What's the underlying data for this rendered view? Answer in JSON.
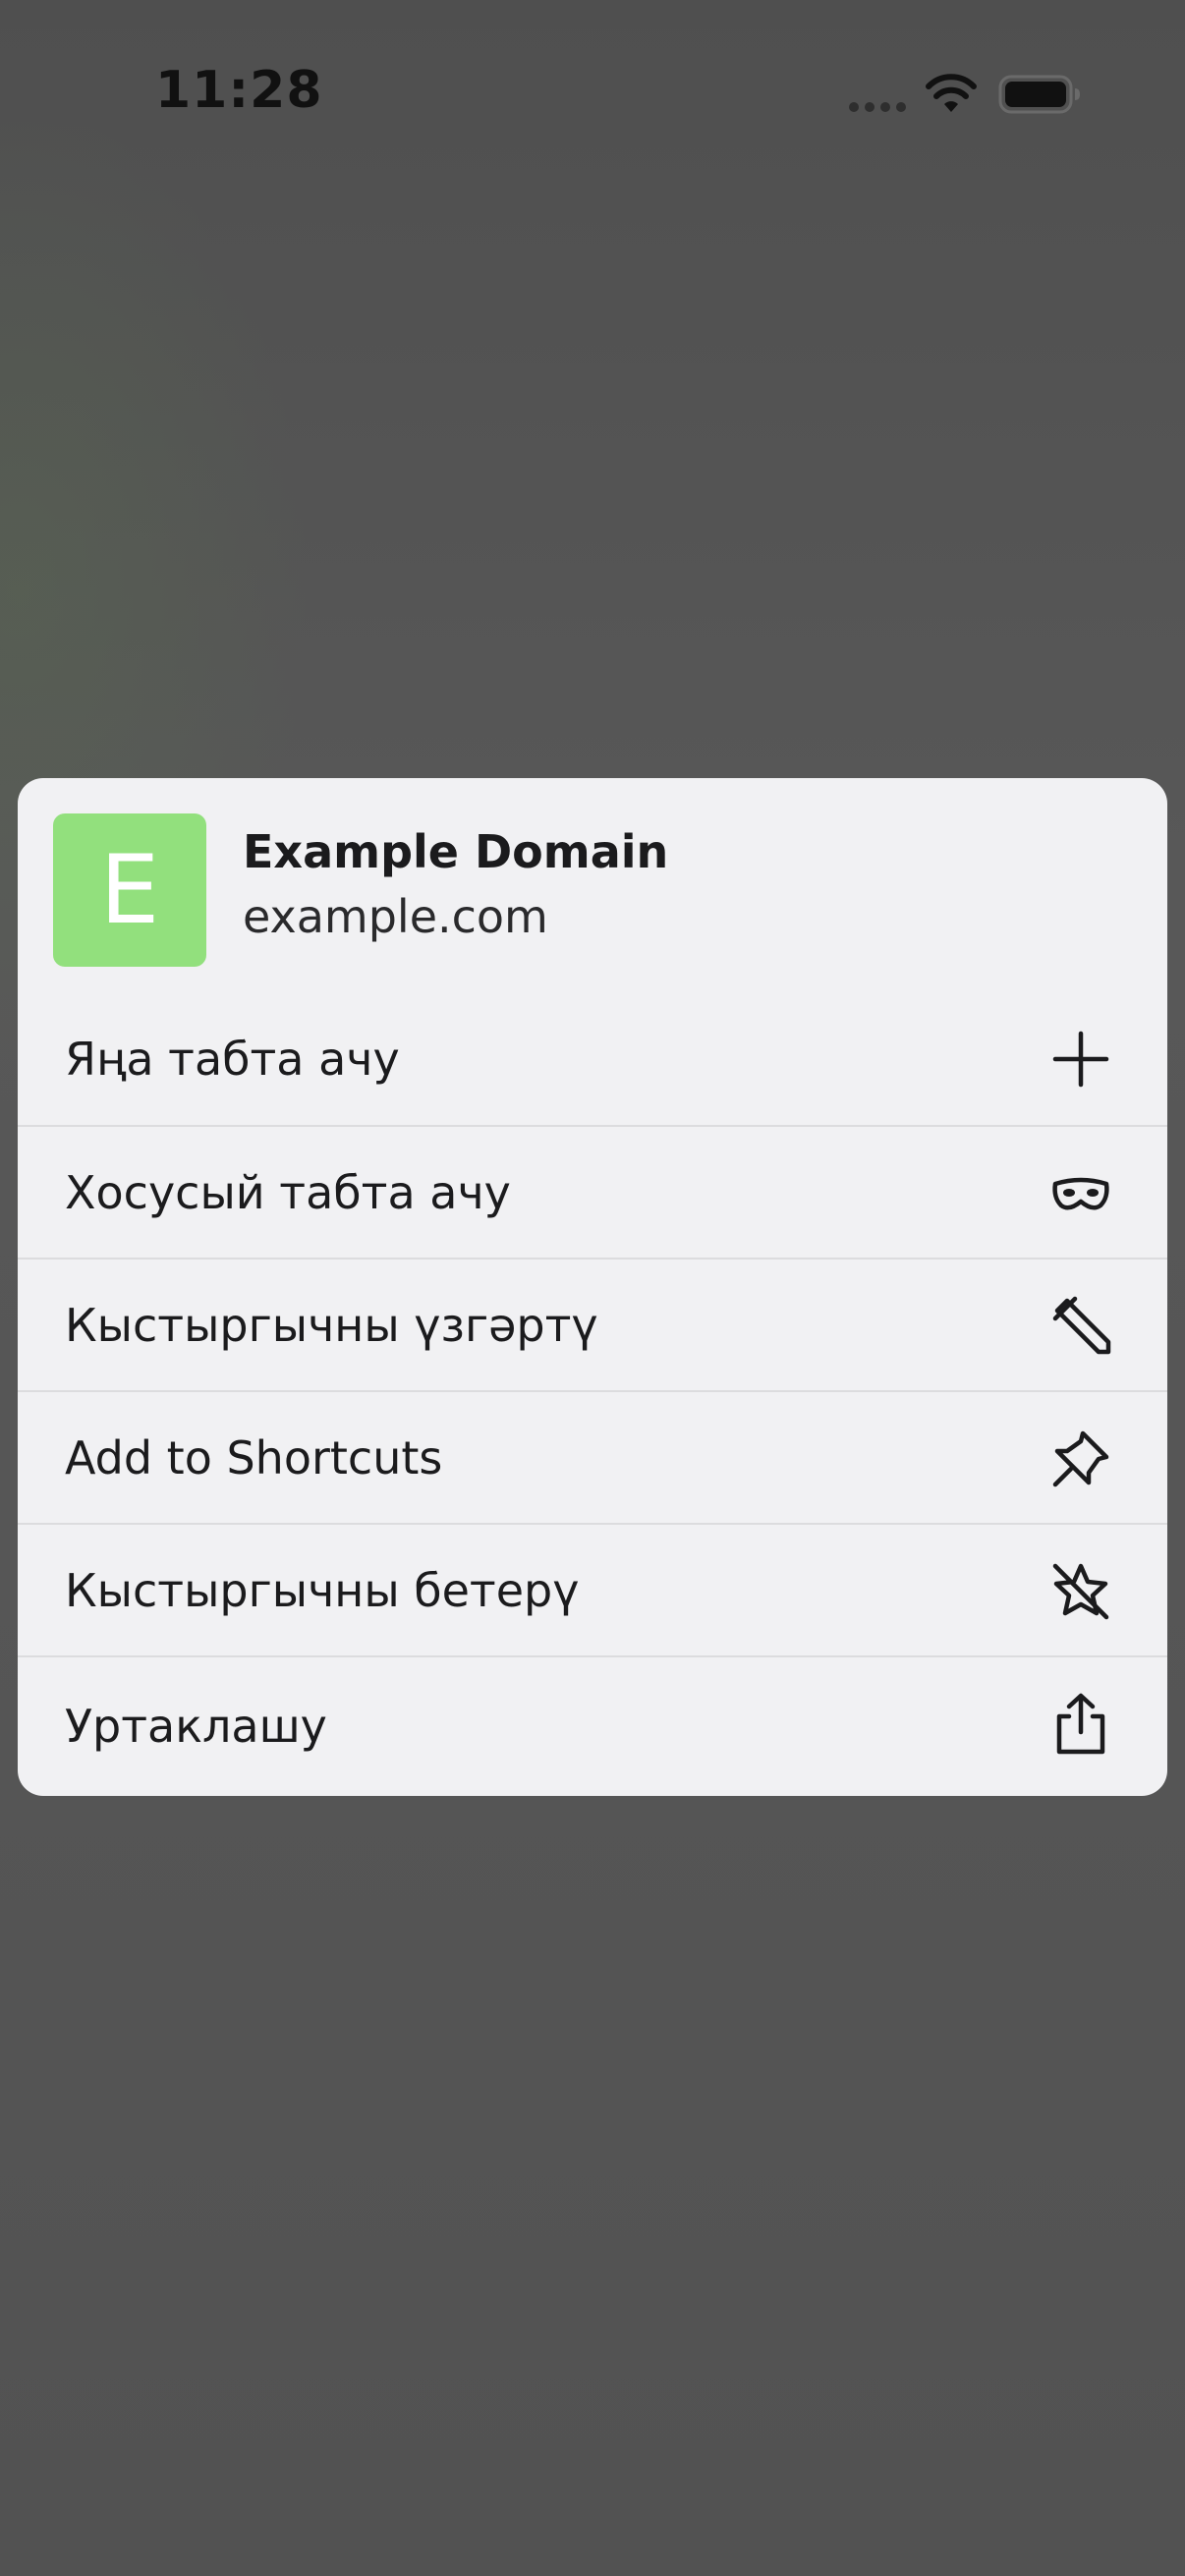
{
  "status_bar": {
    "time": "11:28"
  },
  "menu": {
    "site": {
      "tile_letter": "E",
      "tile_color": "#92e07d",
      "title": "Example Domain",
      "url": "example.com"
    },
    "items": [
      {
        "label": "Яңа табта ачу",
        "icon": "plus-icon"
      },
      {
        "label": "Хосусый табта ачу",
        "icon": "private-mask-icon"
      },
      {
        "label": "Кыстыргычны үзгәртү",
        "icon": "pencil-icon"
      },
      {
        "label": "Add to Shortcuts",
        "icon": "pin-icon"
      },
      {
        "label": "Кыстыргычны бетерү",
        "icon": "star-slash-icon"
      },
      {
        "label": "Уртаклашу",
        "icon": "share-icon"
      }
    ]
  },
  "colors": {
    "backdrop": "#555555",
    "menu_background": "#f1f1f3",
    "divider": "#dcdcde",
    "text": "#1b1b1d"
  }
}
